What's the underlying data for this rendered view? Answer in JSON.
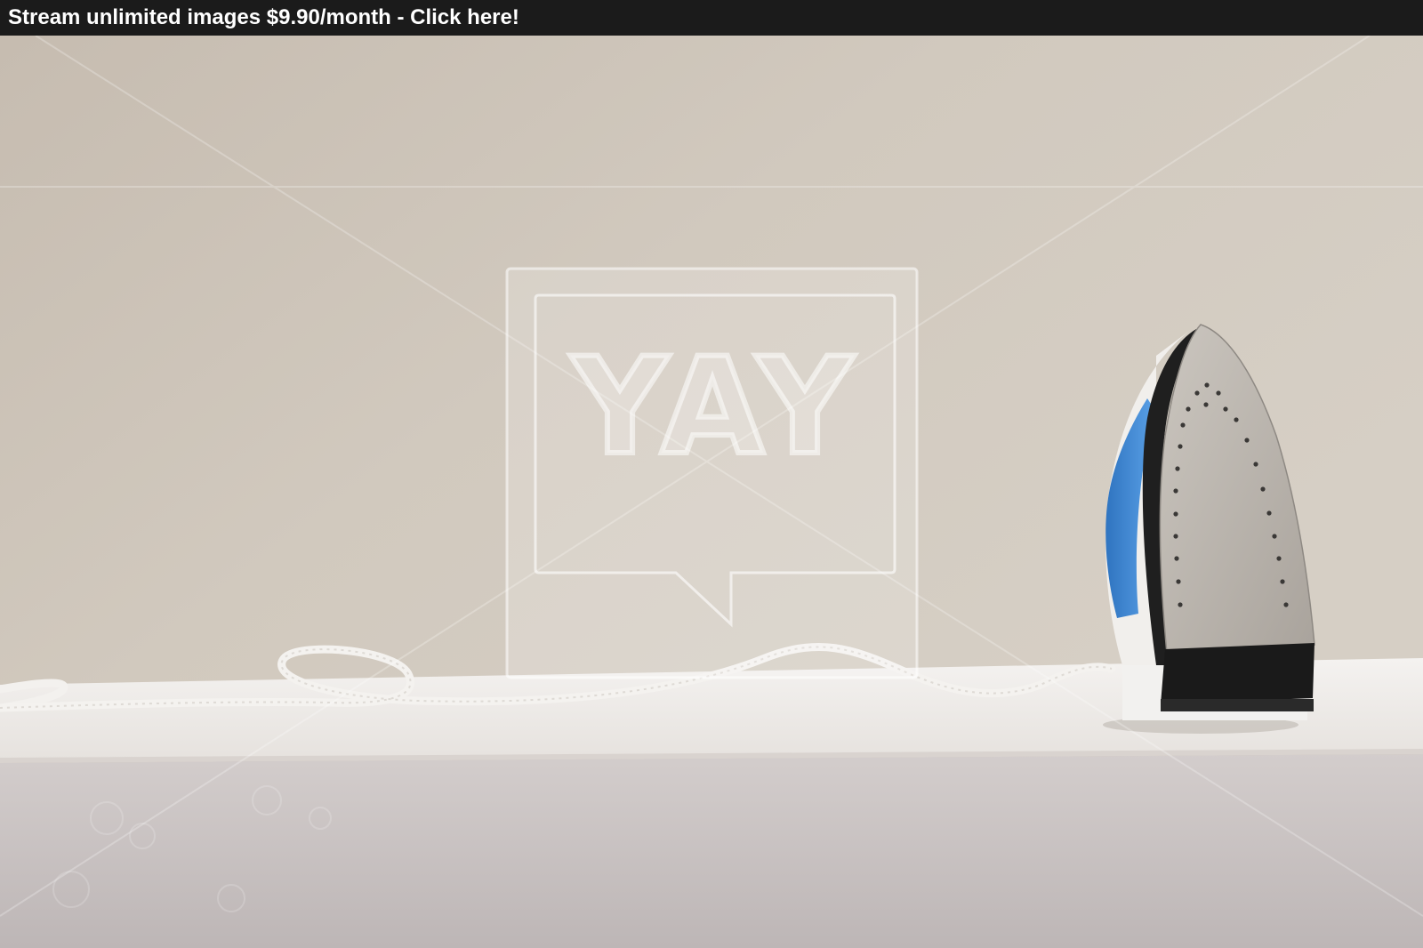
{
  "banner": {
    "text": "Stream unlimited images $9.90/month - Click here!"
  },
  "watermark": {
    "text": "YAY"
  },
  "photo": {
    "subject": "steam iron standing on an ironing board with its cord trailing to the left",
    "colors": {
      "wall": "#cdc4b9",
      "board_top": "#ece9e6",
      "board_front": "#ccc6c6",
      "iron_accent": "#3c86d4",
      "soleplate": "#b9b4ad",
      "iron_base": "#1e1e1e"
    }
  }
}
